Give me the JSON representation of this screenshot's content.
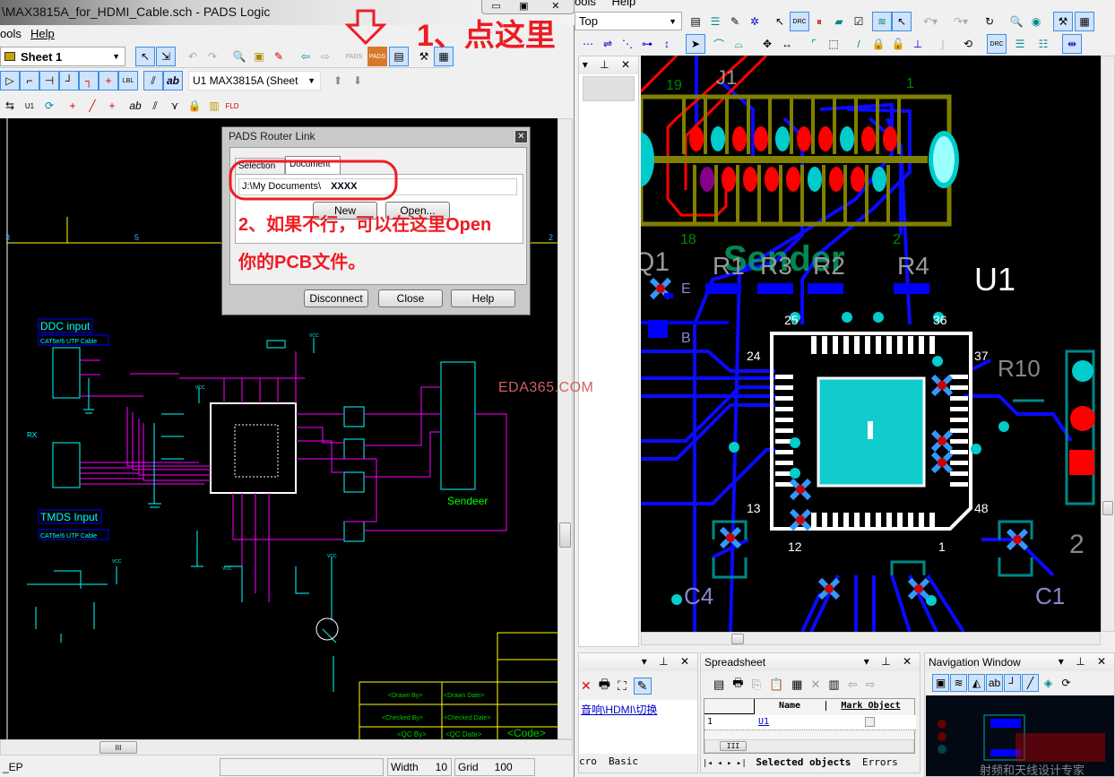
{
  "logic_window": {
    "title": "\\MAX3815A_for_HDMI_Cable.sch - PADS Logic",
    "menu": [
      "ools",
      "Help"
    ],
    "sheet_combo": "Sheet 1",
    "part_combo": "U1 MAX3815A (Sheet",
    "status": {
      "left": "_EP",
      "width_label": "Width",
      "width_value": "10",
      "grid_label": "Grid",
      "grid_value": "100"
    }
  },
  "annotations": {
    "step1": "1、点这里",
    "step2_line1": "2、如果不行，可以在这里Open",
    "step2_line2": "你的PCB文件。"
  },
  "dialog": {
    "title": "PADS Router Link",
    "tabs": [
      "Selection",
      "Document"
    ],
    "path_value": "J:\\My Documents\\",
    "path_bold": "XXXX",
    "new_button": "New",
    "open_button": "Open...",
    "disconnect_button": "Disconnect",
    "close_button": "Close",
    "help_button": "Help"
  },
  "schematic": {
    "ruler_marks": [
      "3",
      "5",
      "2"
    ],
    "ddc_input": "DDC input",
    "cable1": "CAT5e/6 UTP Cable",
    "rx": "RX",
    "tmds_input": "TMDS Input",
    "cable2": "CAT5e/6 UTP Cable",
    "sender": "Sendeer",
    "vcc": "VCC",
    "title_block": {
      "drawn_by": "<Drawn By>",
      "drawn_date": "<Drawn Date>",
      "checked_by": "<Checked By>",
      "checked_date": "<Checked Date>",
      "qc_by": "<QC By>",
      "qc_date": "<QC Date>",
      "code": "<Code>"
    }
  },
  "router_window": {
    "menu": [
      "ools",
      "Help"
    ],
    "layer_combo": "Top",
    "pcb_labels": {
      "pin19": "19",
      "pin1": "1",
      "pin18": "18",
      "pin2": "2",
      "j1": "J1",
      "u1": "U1",
      "r1": "R1",
      "r2": "R2",
      "r3": "R3",
      "r4": "R4",
      "r10": "R10",
      "c1": "C1",
      "c4": "C4",
      "q1": "Q1",
      "e": "E",
      "b": "B",
      "sender": "Sender",
      "p25": "25",
      "p36": "36",
      "p24": "24",
      "p37": "37",
      "p13": "13",
      "p48": "48",
      "p12": "12",
      "p1": "1",
      "two": "2"
    },
    "watermark": "EDA365.COM",
    "left_panel": {
      "link": "音响\\HDMI\\切换",
      "tabs": [
        "cro",
        "Basic"
      ]
    },
    "spreadsheet": {
      "title": "Spreadsheet",
      "columns": [
        "Name",
        "Mark Object"
      ],
      "rows": [
        {
          "index": "1",
          "name": "U1",
          "marked": false
        }
      ],
      "tabs": [
        "Selected objects",
        "Errors"
      ]
    },
    "navigation": {
      "title": "Navigation Window",
      "watermark_sub": "射频和天线设计专家"
    }
  }
}
